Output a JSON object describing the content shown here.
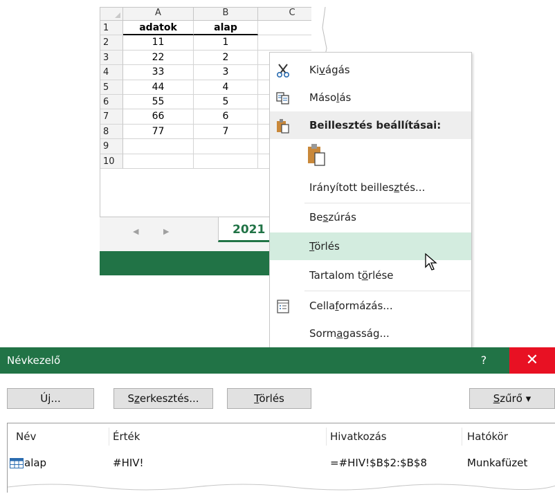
{
  "sheet": {
    "columns": [
      "A",
      "B",
      "C"
    ],
    "rows": [
      {
        "n": "1",
        "a": "adatok",
        "b": "alap"
      },
      {
        "n": "2",
        "a": "11",
        "b": "1"
      },
      {
        "n": "3",
        "a": "22",
        "b": "2"
      },
      {
        "n": "4",
        "a": "33",
        "b": "3"
      },
      {
        "n": "5",
        "a": "44",
        "b": "4"
      },
      {
        "n": "6",
        "a": "55",
        "b": "5"
      },
      {
        "n": "7",
        "a": "66",
        "b": "6"
      },
      {
        "n": "8",
        "a": "77",
        "b": "7"
      },
      {
        "n": "9",
        "a": "",
        "b": ""
      },
      {
        "n": "10",
        "a": "",
        "b": ""
      }
    ],
    "tab_label": "2021",
    "nav_prev": "◀",
    "nav_next": "▶"
  },
  "context_menu": {
    "cut": {
      "pre": "Ki",
      "u": "v",
      "post": "ágás"
    },
    "copy": {
      "pre": "Máso",
      "u": "l",
      "post": "ás"
    },
    "paste_header": "Beillesztés beállításai:",
    "paste_special": {
      "pre": "Irányított beilles",
      "u": "z",
      "post": "tés..."
    },
    "insert": {
      "pre": "Be",
      "u": "s",
      "post": "zúrás"
    },
    "delete": {
      "pre": "",
      "u": "T",
      "post": "örlés"
    },
    "clear": {
      "pre": "Tartalom t",
      "u": "ö",
      "post": "rlése"
    },
    "format": {
      "pre": "Cella",
      "u": "f",
      "post": "ormázás..."
    },
    "row_height": {
      "pre": "Sorm",
      "u": "a",
      "post": "gasság..."
    }
  },
  "dialog": {
    "title": "Névkezelő",
    "help": "?",
    "close": "✕",
    "buttons": {
      "new": {
        "pre": "Ú",
        "u": "j",
        "post": "..."
      },
      "edit": {
        "pre": "S",
        "u": "z",
        "post": "erkesztés..."
      },
      "delete": {
        "pre": "",
        "u": "T",
        "post": "örlés"
      },
      "filter": {
        "pre": "",
        "u": "S",
        "post": "zűrő ▾"
      }
    },
    "columns": [
      "Név",
      "Érték",
      "Hivatkozás",
      "Hatókör"
    ],
    "row": {
      "name": "alap",
      "value": "#HIV!",
      "ref": "=#HIV!$B$2:$B$8",
      "scope": "Munkafüzet"
    }
  },
  "colors": {
    "accent": "#217346",
    "hover": "#d3ecdf",
    "close": "#e81123"
  }
}
